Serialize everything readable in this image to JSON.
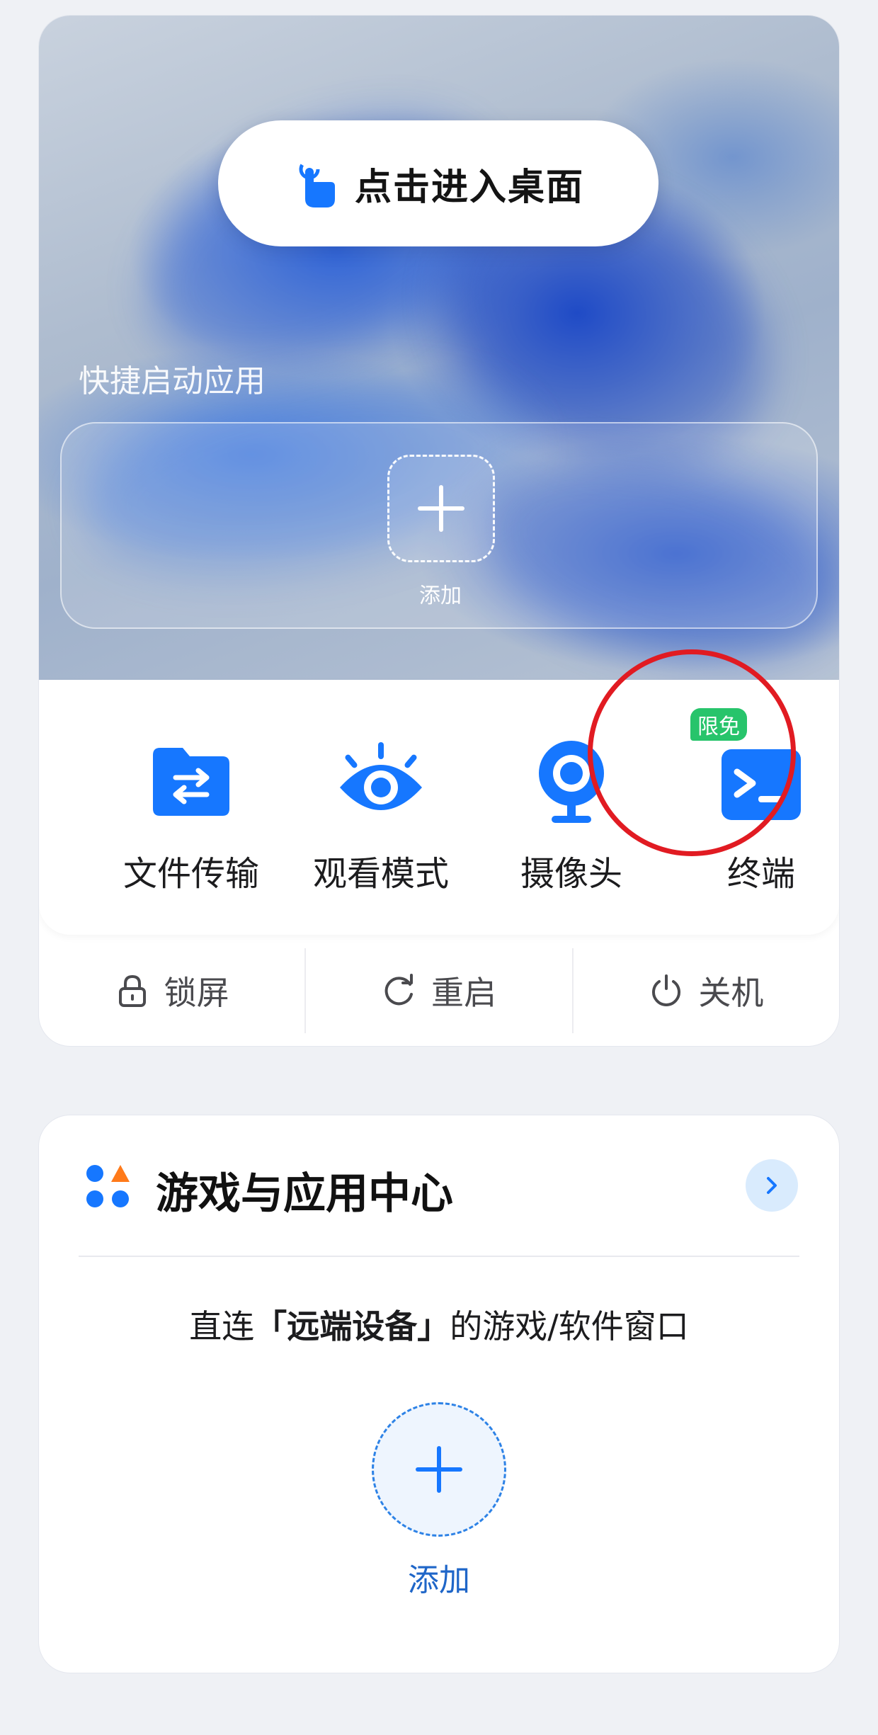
{
  "colors": {
    "accent_blue": "#1677ff",
    "badge_green": "#27c46b",
    "highlight_red": "#e11b22",
    "add_label_blue": "#1f66c8"
  },
  "hero": {
    "enter_button": {
      "label": "点击进入桌面",
      "icon": "hand-tap-icon"
    },
    "quick_launch": {
      "title": "快捷启动应用",
      "add_label": "添加"
    }
  },
  "tools": [
    {
      "label": "文件传输",
      "icon": "file-transfer-icon"
    },
    {
      "label": "观看模式",
      "icon": "eye-icon"
    },
    {
      "label": "摄像头",
      "icon": "webcam-icon"
    },
    {
      "label": "终端",
      "icon": "terminal-icon",
      "badge": "限免"
    }
  ],
  "actions": [
    {
      "label": "锁屏",
      "icon": "lock-icon"
    },
    {
      "label": "重启",
      "icon": "restart-icon"
    },
    {
      "label": "关机",
      "icon": "power-icon"
    }
  ],
  "games": {
    "title": "游戏与应用中心",
    "desc_prefix": "直连",
    "desc_bold": "「远端设备」",
    "desc_suffix": "的游戏/软件窗口",
    "add_label": "添加"
  }
}
